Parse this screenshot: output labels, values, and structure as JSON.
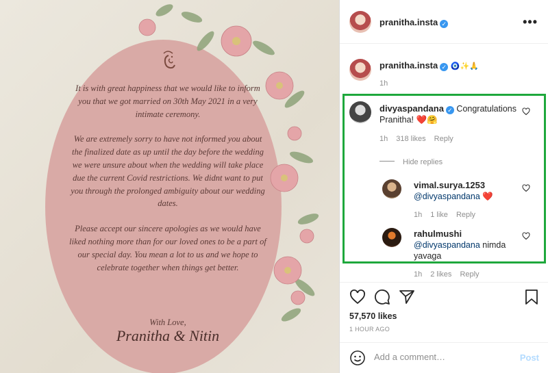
{
  "post": {
    "card": {
      "paragraphs": [
        "It is with great happiness that we would like to inform you that we got married on 30th May 2021 in a very intimate ceremony.",
        "We are extremely sorry to have not informed you about the finalized date as up until the day before the wedding we were unsure about when the wedding will take place due the current Covid restrictions. We didnt want to put you through the prolonged ambiguity about our wedding dates.",
        "Please accept our sincere apologies as we would have liked nothing more than for our loved ones to be a part of our special day. You mean a lot to us and we hope to celebrate together when things get better."
      ],
      "signoff": "With Love,",
      "signature": "Pranitha & Nitin"
    }
  },
  "header": {
    "username": "pranitha.insta",
    "verified_glyph": "✓",
    "more_label": "•••"
  },
  "caption": {
    "username": "pranitha.insta",
    "emojis": "🧿✨🙏",
    "time": "1h"
  },
  "comments": [
    {
      "username": "divyaspandana",
      "verified_glyph": "✓",
      "text": "Congratulations Pranitha!",
      "emojis": "❤️🤗",
      "time": "1h",
      "likes": "318 likes",
      "reply": "Reply"
    }
  ],
  "hide_replies": "Hide replies",
  "replies": [
    {
      "username": "vimal.surya.1253",
      "mention": "@divyaspandana",
      "text": "",
      "emojis": "❤️",
      "time": "1h",
      "likes": "1 like",
      "reply": "Reply"
    },
    {
      "username": "rahulmushi",
      "mention": "@divyaspandana",
      "text": "nimda yavaga",
      "emojis": "",
      "time": "1h",
      "likes": "2 likes",
      "reply": "Reply"
    }
  ],
  "footer": {
    "likes": "57,570 likes",
    "time": "1 HOUR AGO",
    "comment_placeholder": "Add a comment…",
    "post_label": "Post"
  },
  "colors": {
    "highlight_box": "#1ea83c",
    "verified": "#3897f0",
    "oval": "#d9aaa6"
  }
}
